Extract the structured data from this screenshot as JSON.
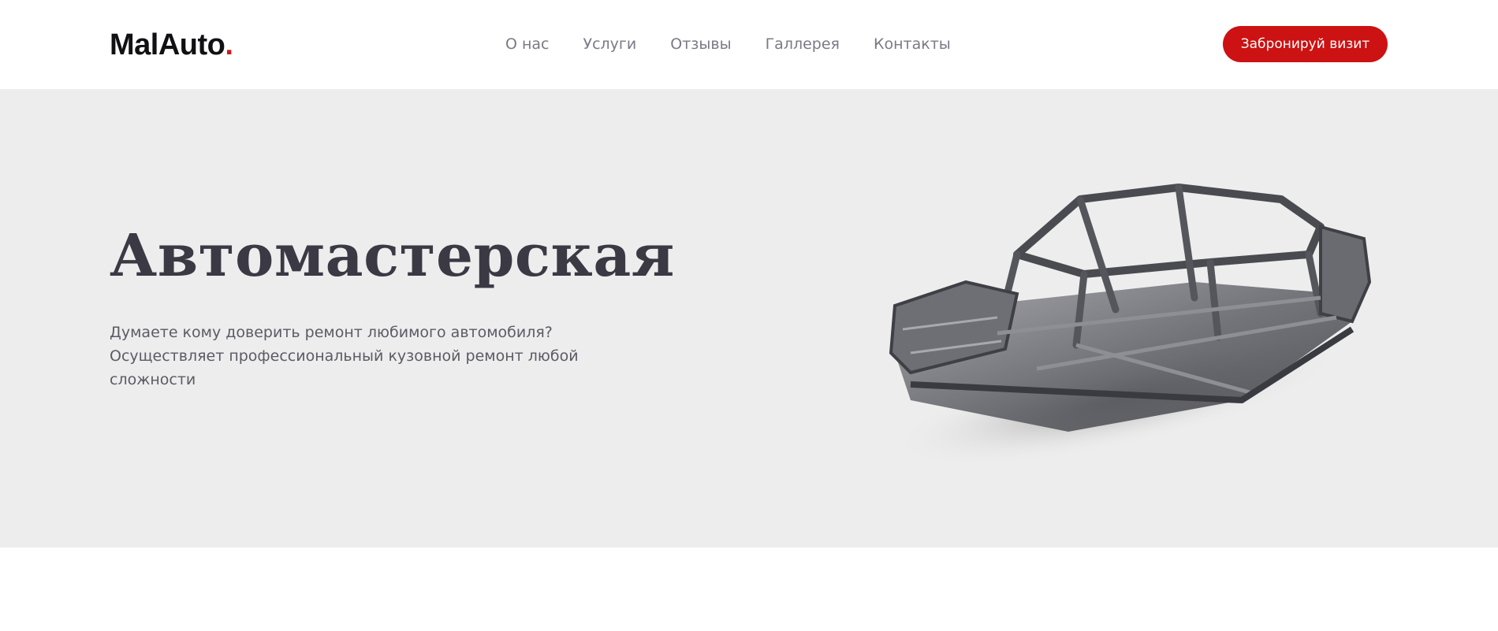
{
  "header": {
    "logo_text": "MalAuto",
    "logo_dot": ".",
    "nav": [
      {
        "label": "О нас"
      },
      {
        "label": "Услуги"
      },
      {
        "label": "Отзывы"
      },
      {
        "label": "Галлерея"
      },
      {
        "label": "Контакты"
      }
    ],
    "cta_label": "Забронируй визит"
  },
  "hero": {
    "title": "Автомастерская",
    "text": "Думаете кому доверить ремонт любимого автомобиля? Осуществляет профессиональный кузовной ремонт любой сложности",
    "image": "car-body-frame-image"
  },
  "colors": {
    "accent": "#cc1213",
    "hero_bg": "#ededed",
    "title": "#3a3944",
    "nav": "#7a7a86"
  }
}
